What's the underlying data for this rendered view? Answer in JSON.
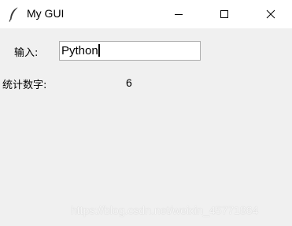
{
  "window": {
    "title": "My GUI",
    "icon": "feather-icon",
    "controls": [
      "minimize-icon",
      "maximize-icon",
      "close-icon"
    ]
  },
  "form": {
    "input_label": "输入:",
    "input_value": "Python",
    "count_label": "统计数字:",
    "count_value": "6"
  },
  "watermark": "https://blog.csdn.net/weixin_45771864"
}
